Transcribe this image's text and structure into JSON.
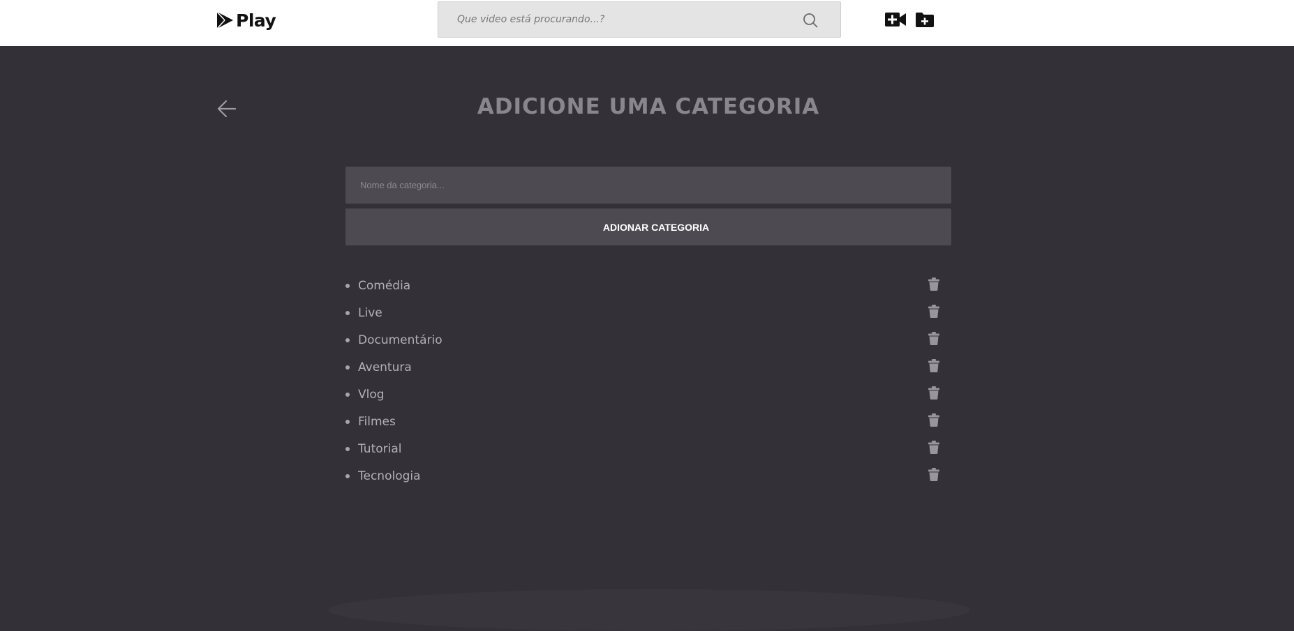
{
  "header": {
    "logo_text": "Play",
    "search_placeholder": "Que video está procurando...?",
    "icons": [
      "search-icon",
      "add-video-icon",
      "add-folder-icon"
    ]
  },
  "main": {
    "title": "ADICIONE UMA CATEGORIA",
    "input_placeholder": "Nome da categoria...",
    "add_button_label": "ADIONAR CATEGORIA",
    "categories": [
      "Comédia",
      "Live",
      "Documentário",
      "Aventura",
      "Vlog",
      "Filmes",
      "Tutorial",
      "Tecnologia"
    ]
  },
  "colors": {
    "background": "#333137",
    "header": "#ffffff",
    "panel": "#4d4a51",
    "title": "#8a878c",
    "text": "#b3b0b5"
  }
}
